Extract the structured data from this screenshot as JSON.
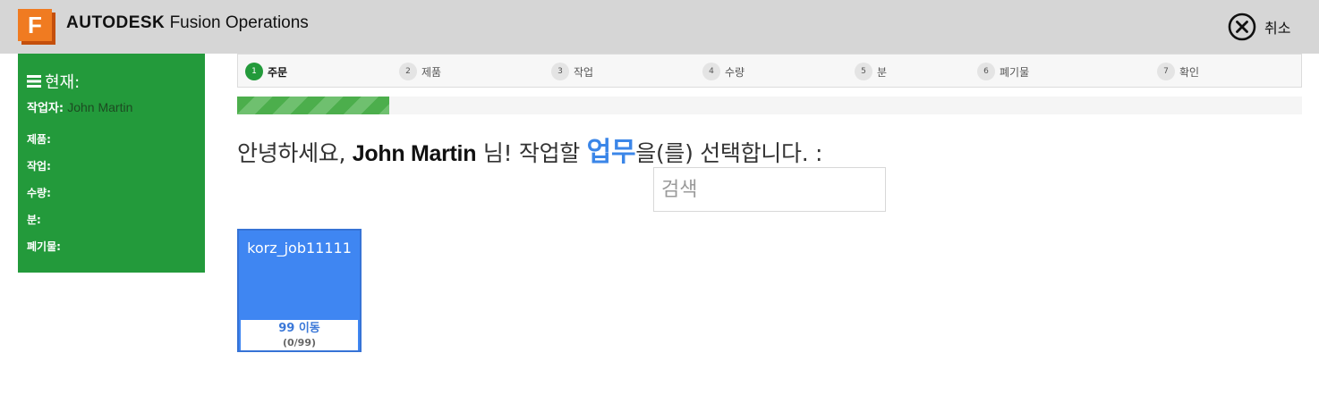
{
  "header": {
    "logo_letter": "F",
    "brand_bold": "AUTODESK",
    "brand_rest": "Fusion Operations",
    "cancel_label": "취소",
    "background": "#d6d6d6",
    "logo_color": "#f07b21"
  },
  "sidebar": {
    "title": "현재:",
    "title_icon": "menu-icon",
    "worker_label": "작업자:",
    "worker_value": "John Martin",
    "rows": [
      "제품:",
      "작업:",
      "수량:",
      "분:",
      "폐기물:"
    ],
    "background": "#239a3b"
  },
  "steps": [
    {
      "num": "1",
      "label": "주문",
      "active": true
    },
    {
      "num": "2",
      "label": "제품",
      "active": false
    },
    {
      "num": "3",
      "label": "작업",
      "active": false
    },
    {
      "num": "4",
      "label": "수량",
      "active": false
    },
    {
      "num": "5",
      "label": "분",
      "active": false
    },
    {
      "num": "6",
      "label": "폐기물",
      "active": false
    },
    {
      "num": "7",
      "label": "확인",
      "active": false
    }
  ],
  "progress": {
    "fraction": 0.143,
    "color": "#4cae4c"
  },
  "greeting": {
    "prefix": "안녕하세요, ",
    "name": "John Martin",
    "middle": " 님! 작업할 ",
    "highlight": "업무",
    "suffix": "을(를) 선택합니다. :"
  },
  "search": {
    "placeholder": "검색",
    "value": ""
  },
  "jobs": [
    {
      "name": "korz_job11111",
      "moves": "99 이동",
      "count": "(0/99)",
      "color": "#3f86f2"
    }
  ]
}
